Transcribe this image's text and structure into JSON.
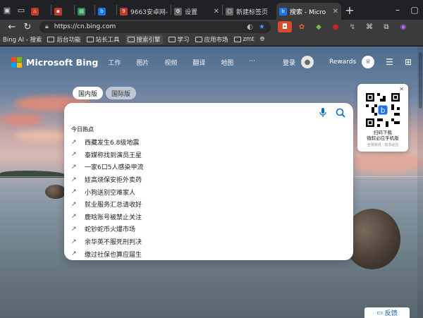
{
  "tabs": [
    {
      "title": "",
      "fav_color": "#c0392b",
      "fav_glyph": "♨"
    },
    {
      "title": "",
      "fav_color": "#c0392b",
      "fav_glyph": "▪"
    },
    {
      "title": "",
      "fav_color": "#2e8b57",
      "fav_glyph": "▤"
    },
    {
      "title": "",
      "fav_color": "#1a73e8",
      "fav_glyph": "b"
    },
    {
      "title": "9663安卓网-",
      "fav_color": "#c0392b",
      "fav_glyph": "9"
    },
    {
      "title": "设置",
      "fav_color": "#888888",
      "fav_glyph": "⚙"
    },
    {
      "title": "新建标签页",
      "fav_color": "#888888",
      "fav_glyph": "▢"
    },
    {
      "title": "搜索 - Micro",
      "fav_color": "#1a73e8",
      "fav_glyph": "b",
      "active": true
    }
  ],
  "omnibox": {
    "url": "https://cn.bing.com"
  },
  "bookmarks": [
    {
      "label": "Bing AI - 搜索",
      "type": "link"
    },
    {
      "label": "后台功能",
      "type": "folder"
    },
    {
      "label": "站长工具",
      "type": "folder"
    },
    {
      "label": "搜索引擎",
      "type": "folder"
    },
    {
      "label": "学习",
      "type": "folder"
    },
    {
      "label": "应用市场",
      "type": "folder"
    },
    {
      "label": "zmt",
      "type": "folder"
    }
  ],
  "bing": {
    "brand": "Microsoft Bing",
    "nav": [
      "工作",
      "图片",
      "视频",
      "翻译",
      "地图",
      "···"
    ],
    "login": "登录",
    "rewards": "Rewards",
    "region_tabs": [
      "国内版",
      "国际版"
    ],
    "search_placeholder": "",
    "hot_title": "今日热点",
    "hot_items": [
      "西藏发生6.8级地震",
      "泰媒称找到演员王星",
      "一家6口5人感染甲流",
      "娃高烧保安拒外卖药",
      "小狗送别空难家人",
      "就业服务汇总请收好",
      "鹿晗账号被禁止关注",
      "蛇钞蛇币火爆市场",
      "余华英不服死刑判决",
      "缴过社保也算应届生"
    ],
    "qr_line1": "扫码下载",
    "qr_line2": "微软必应手机版",
    "qr_line3": "全球资讯 · 有求必应",
    "feedback": "反馈"
  },
  "colors": {
    "accent": "#0b6fb8",
    "tab_bg": "#202124",
    "toolbar_bg": "#3b3b3b"
  }
}
